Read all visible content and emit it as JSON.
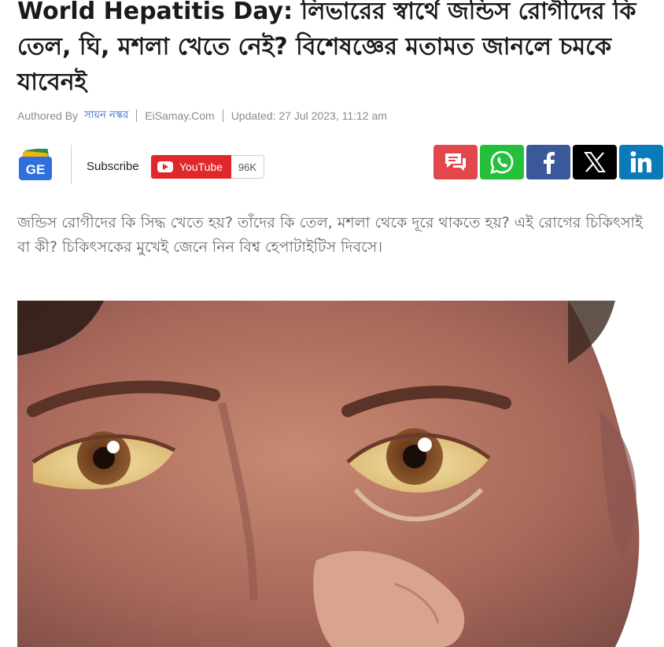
{
  "article": {
    "headline": "World Hepatitis Day: লিভারের স্বার্থে জন্ডিস রোগীদের কি তেল, ঘি, মশলা খেতে নেই? বিশেষজ্ঞের মতামত জানলে চমকে যাবেনই",
    "byline": {
      "authored_by_label": "Authored By",
      "author": "সায়ন নস্কর",
      "source": "EiSamay.Com",
      "updated": "Updated: 27 Jul 2023, 11:12 am"
    },
    "summary": "জন্ডিস রোগীদের কি সিদ্ধ খেতে হয়? তাঁদের কি তেল, মশলা থেকে দূরে থাকতে হয়? এই রোগের চিকিৎসাই বা কী? চিকিৎসকের মুখেই জেনে নিন বিশ্ব হেপাটাইটিস দিবসে।"
  },
  "social": {
    "google_news_icon": "google-news-logo",
    "subscribe_label": "Subscribe",
    "youtube_label": "YouTube",
    "youtube_count": "96K",
    "share_buttons": [
      {
        "name": "comments",
        "icon": "comment-icon",
        "color": "#e2474c"
      },
      {
        "name": "whatsapp",
        "icon": "whatsapp-icon",
        "color": "#25c03b"
      },
      {
        "name": "facebook",
        "icon": "facebook-icon",
        "color": "#3b5998"
      },
      {
        "name": "x",
        "icon": "x-icon",
        "color": "#000000"
      },
      {
        "name": "linkedin",
        "icon": "linkedin-icon",
        "color": "#0a7bb8"
      }
    ]
  },
  "colors": {
    "author_link": "#1f5fbf",
    "youtube_red": "#e0282a",
    "summary_text": "#6b6b6b"
  },
  "hero_image": {
    "subject": "face-with-yellow-eyes-photo"
  }
}
